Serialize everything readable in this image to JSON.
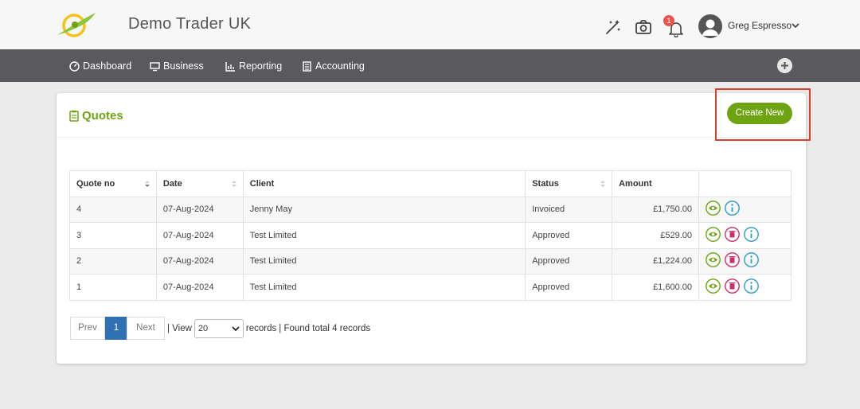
{
  "header": {
    "company_name": "Demo Trader UK",
    "notification_count": "1",
    "user_name": "Greg Espresso",
    "icons": [
      "logo-icon",
      "magic-wand-icon",
      "camera-icon",
      "bell-icon",
      "avatar-icon",
      "chevron-down-icon"
    ]
  },
  "nav": {
    "items": [
      {
        "label": "Dashboard",
        "icon": "dashboard-icon"
      },
      {
        "label": "Business",
        "icon": "business-icon"
      },
      {
        "label": "Reporting",
        "icon": "reporting-icon"
      },
      {
        "label": "Accounting",
        "icon": "accounting-icon"
      }
    ],
    "plus_icon": "plus-circle-icon"
  },
  "page": {
    "title": "Quotes",
    "title_icon": "clipboard-icon",
    "create_button": "Create New"
  },
  "table": {
    "columns": [
      "Quote no",
      "Date",
      "Client",
      "Status",
      "Amount",
      ""
    ],
    "rows": [
      {
        "quote_no": "4",
        "date": "07-Aug-2024",
        "client": "Jenny May",
        "status": "Invoiced",
        "amount": "£1,750.00",
        "actions": [
          "view",
          "info"
        ]
      },
      {
        "quote_no": "3",
        "date": "07-Aug-2024",
        "client": "Test Limited",
        "status": "Approved",
        "amount": "£529.00",
        "actions": [
          "view",
          "delete",
          "info"
        ]
      },
      {
        "quote_no": "2",
        "date": "07-Aug-2024",
        "client": "Test Limited",
        "status": "Approved",
        "amount": "£1,224.00",
        "actions": [
          "view",
          "delete",
          "info"
        ]
      },
      {
        "quote_no": "1",
        "date": "07-Aug-2024",
        "client": "Test Limited",
        "status": "Approved",
        "amount": "£1,600.00",
        "actions": [
          "view",
          "delete",
          "info"
        ]
      }
    ]
  },
  "pagination": {
    "prev": "Prev",
    "current_page": "1",
    "next": "Next",
    "view_label": "| View",
    "page_size": "20",
    "records_label": "records",
    "found_label": "| Found total 4 records"
  },
  "colors": {
    "accent_green": "#6ea312",
    "nav_bg": "#5a5a5e",
    "page_active": "#3071b3",
    "highlight_red": "#d9412f",
    "view_icon": "#6ea312",
    "delete_icon": "#c8306a",
    "info_icon": "#2b9bc7"
  }
}
